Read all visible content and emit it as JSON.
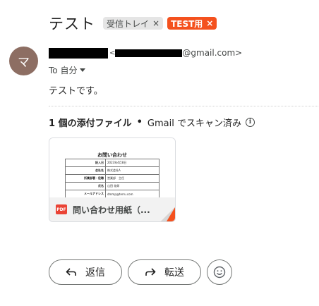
{
  "subject": "テスト",
  "labels": [
    {
      "text": "受信トレイ",
      "remove": "×"
    },
    {
      "text": "TEST用",
      "remove": "×"
    }
  ],
  "sender": {
    "avatar_initial": "マ",
    "address_open": "<",
    "address_domain": "@gmail.com>",
    "to_label": "To 自分"
  },
  "body": "テストです。",
  "attachments": {
    "count_label": "1 個の添付ファイル",
    "separator": "•",
    "scan_label": "Gmail でスキャン済み",
    "info_icon": "i",
    "file": {
      "type_badge": "PDF",
      "name": "問い合わせ用紙（...",
      "preview": {
        "title": "お問い合わせ",
        "rows": [
          {
            "key": "記入日",
            "value": "2023年4月8日"
          },
          {
            "key": "会社名",
            "value": "株式会社A"
          },
          {
            "key": "所属部署・役職",
            "value": "営業部　主任"
          },
          {
            "key": "氏名",
            "value": "山田 花郎"
          },
          {
            "key": "メールアドレス",
            "value": "dmmp@terru.com"
          },
          {
            "key": "",
            "value": ""
          }
        ]
      }
    }
  },
  "actions": {
    "reply": "返信",
    "forward": "転送"
  },
  "icons": {
    "reply": "reply-icon",
    "forward": "forward-icon",
    "emoji": "emoji-icon",
    "info": "info-icon",
    "caret": "chevron-down-icon",
    "pdf": "pdf-icon"
  },
  "colors": {
    "test_label": "#f4511e",
    "avatar": "#8d6e63",
    "pdf_badge": "#ea4335"
  }
}
